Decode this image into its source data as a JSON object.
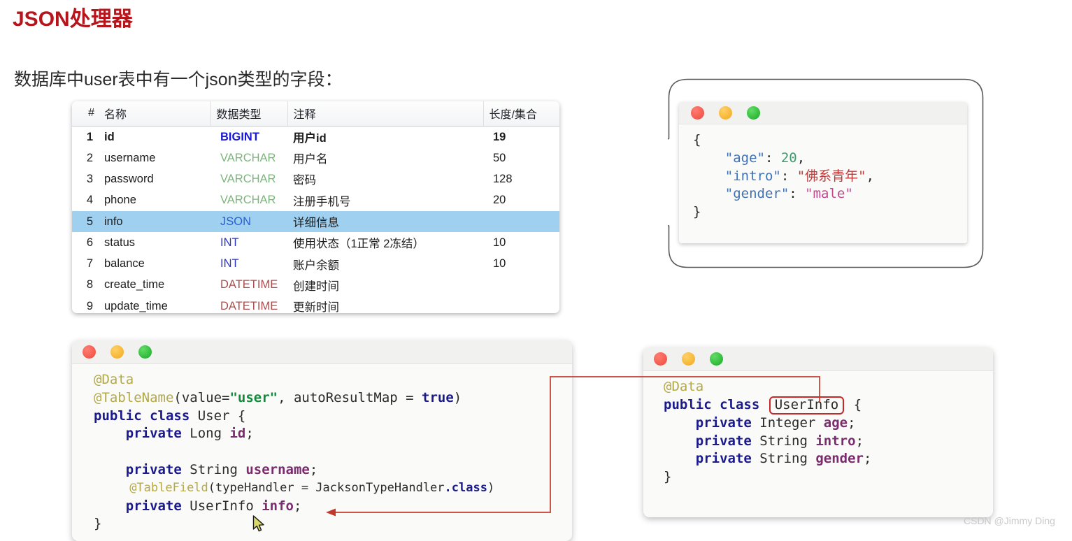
{
  "page_title": "JSON处理器",
  "subtitle": "数据库中user表中有一个json类型的字段：",
  "colors": {
    "title_red": "#b5151b",
    "selected_row": "#9fd0ef",
    "annotation_red": "#c62828",
    "dot_red": "#f0483c",
    "dot_yellow": "#f2a91c",
    "dot_green": "#17aa25"
  },
  "db_table": {
    "headers": [
      "#",
      "名称",
      "数据类型",
      "注释",
      "长度/集合"
    ],
    "rows": [
      {
        "num": "1",
        "name": "id",
        "type": "BIGINT",
        "type_class": "t-bigint",
        "comment": "用户id",
        "length": "19",
        "state": "current"
      },
      {
        "num": "2",
        "name": "username",
        "type": "VARCHAR",
        "type_class": "t-varchar",
        "comment": "用户名",
        "length": "50",
        "state": "normal"
      },
      {
        "num": "3",
        "name": "password",
        "type": "VARCHAR",
        "type_class": "t-varchar",
        "comment": "密码",
        "length": "128",
        "state": "normal"
      },
      {
        "num": "4",
        "name": "phone",
        "type": "VARCHAR",
        "type_class": "t-varchar",
        "comment": "注册手机号",
        "length": "20",
        "state": "normal"
      },
      {
        "num": "5",
        "name": "info",
        "type": "JSON",
        "type_class": "t-json",
        "comment": "详细信息",
        "length": "",
        "state": "selected"
      },
      {
        "num": "6",
        "name": "status",
        "type": "INT",
        "type_class": "t-int",
        "comment": "使用状态（1正常 2冻结）",
        "length": "10",
        "state": "normal"
      },
      {
        "num": "7",
        "name": "balance",
        "type": "INT",
        "type_class": "t-int",
        "comment": "账户余额",
        "length": "10",
        "state": "normal"
      },
      {
        "num": "8",
        "name": "create_time",
        "type": "DATETIME",
        "type_class": "t-datetime",
        "comment": "创建时间",
        "length": "",
        "state": "normal"
      },
      {
        "num": "9",
        "name": "update_time",
        "type": "DATETIME",
        "type_class": "t-datetime",
        "comment": "更新时间",
        "length": "",
        "state": "normal"
      }
    ]
  },
  "json_bubble": {
    "traffic_lights": [
      "close-dot",
      "minimize-dot",
      "maximize-dot"
    ],
    "lines": [
      {
        "id": "l1",
        "text": "{"
      },
      {
        "id": "l2",
        "key": "\"age\"",
        "sep": ": ",
        "value": "20",
        "tail": ","
      },
      {
        "id": "l3",
        "key": "\"intro\"",
        "sep": ": ",
        "value": "\"佛系青年\"",
        "tail": ","
      },
      {
        "id": "l4",
        "key": "\"gender\"",
        "sep": ": ",
        "value": "\"male\"",
        "tail": ""
      },
      {
        "id": "l5",
        "text": "}"
      }
    ]
  },
  "user_window": {
    "traffic_lights": [
      "close-dot",
      "minimize-dot",
      "maximize-dot"
    ],
    "code": {
      "l1_ann": "@Data",
      "l2_ann": "@TableName",
      "l2_a": "(value=",
      "l2_str": "\"user\"",
      "l2_b": ", autoResultMap = ",
      "l2_kw": "true",
      "l2_c": ")",
      "l3_kw": "public class",
      "l3_rest": " User {",
      "l4_kw": "private",
      "l4_type": " Long ",
      "l4_field": "id",
      "l4_semi": ";",
      "l5_blank": " ",
      "l6_kw": "private",
      "l6_type": " String ",
      "l6_field": "username",
      "l6_semi": ";",
      "l7_ann": "@TableField",
      "l7_a": "(typeHandler = JacksonTypeHandler",
      "l7_kw": ".class",
      "l7_b": ")",
      "l8_kw": "private",
      "l8_type": " UserInfo ",
      "l8_field": "info",
      "l8_semi": ";",
      "l9": "}"
    }
  },
  "userinfo_window": {
    "traffic_lights": [
      "close-dot",
      "minimize-dot",
      "maximize-dot"
    ],
    "code": {
      "l1_ann": "@Data",
      "l2_kw": "public class",
      "l2_boxed": "UserInfo",
      "l2_tail": "{",
      "l3_kw": "private",
      "l3_type": " Integer ",
      "l3_field": "age",
      "l3_semi": ";",
      "l4_kw": "private",
      "l4_type": " String ",
      "l4_field": "intro",
      "l4_semi": ";",
      "l5_kw": "private",
      "l5_type": " String ",
      "l5_field": "gender",
      "l5_semi": ";",
      "l6": "}"
    }
  },
  "watermark": "CSDN @Jimmy Ding"
}
